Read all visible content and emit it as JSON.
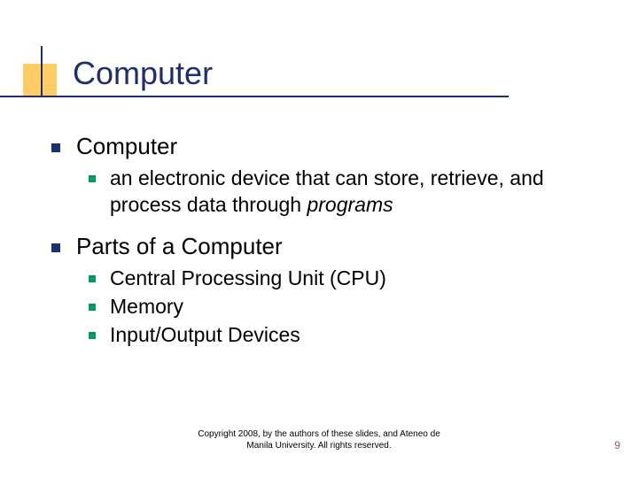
{
  "title": "Computer",
  "sections": [
    {
      "heading": "Computer",
      "items": [
        {
          "pre": "an electronic device that can store, retrieve, and process data through ",
          "italic": "programs"
        }
      ]
    },
    {
      "heading": "Parts of a Computer",
      "items": [
        "Central Processing Unit (CPU)",
        "Memory",
        "Input/Output Devices"
      ]
    }
  ],
  "footer": {
    "line1": "Copyright 2008, by the authors of these slides, and Ateneo de",
    "line2": "Manila University. All rights reserved."
  },
  "page_number": "9",
  "colors": {
    "title_accent": "#ffcc66",
    "rule": "#1f2f6b",
    "bullet_lvl1": "#1f2f6b",
    "bullet_lvl2": "#009966",
    "pagenum": "#9a5a6a"
  }
}
